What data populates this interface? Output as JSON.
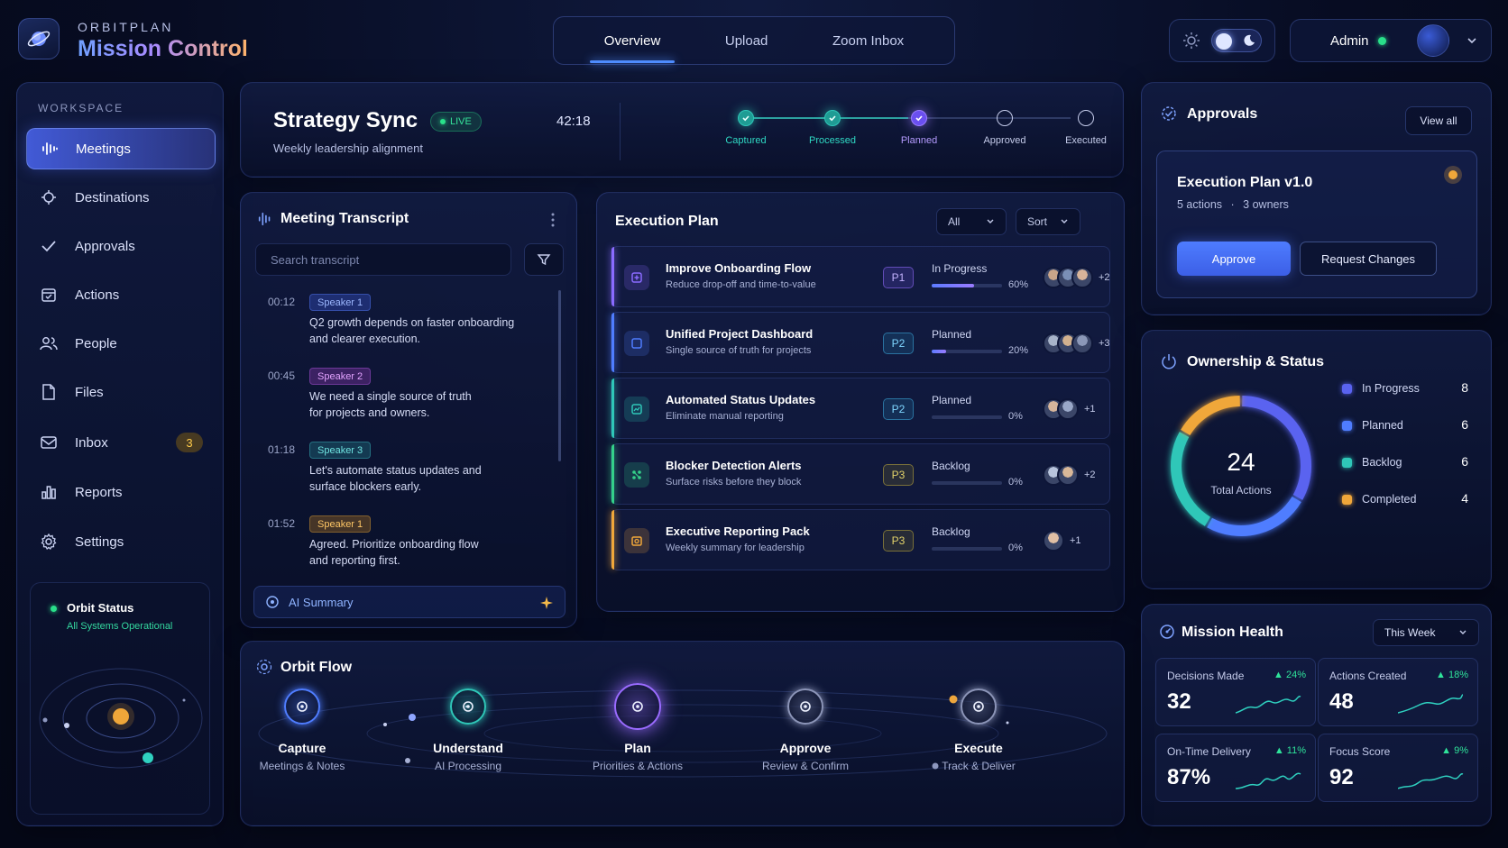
{
  "brand": {
    "top": "ORBITPLAN",
    "main": "Mission Control"
  },
  "nav_tabs": [
    "Overview",
    "Upload",
    "Zoom Inbox"
  ],
  "user": {
    "name": "Admin"
  },
  "sidebar": {
    "section": "WORKSPACE",
    "items": [
      {
        "label": "Meetings",
        "icon": "waveform-icon"
      },
      {
        "label": "Destinations",
        "icon": "target-icon"
      },
      {
        "label": "Approvals",
        "icon": "check-icon"
      },
      {
        "label": "Actions",
        "icon": "calendar-check-icon"
      },
      {
        "label": "People",
        "icon": "people-icon"
      },
      {
        "label": "Files",
        "icon": "file-icon"
      },
      {
        "label": "Inbox",
        "icon": "inbox-icon",
        "badge": "3"
      },
      {
        "label": "Reports",
        "icon": "bar-chart-icon"
      },
      {
        "label": "Settings",
        "icon": "gear-icon"
      }
    ],
    "orbit_status": {
      "title": "Orbit Status",
      "subtitle": "All Systems Operational"
    }
  },
  "meeting": {
    "title": "Strategy Sync",
    "live": "LIVE",
    "subtitle": "Weekly leadership alignment",
    "time": "42:18",
    "pipeline": [
      {
        "label": "Captured",
        "state": "done"
      },
      {
        "label": "Processed",
        "state": "done"
      },
      {
        "label": "Planned",
        "state": "current"
      },
      {
        "label": "Approved",
        "state": "todo"
      },
      {
        "label": "Executed",
        "state": "todo"
      }
    ]
  },
  "transcript": {
    "title": "Meeting Transcript",
    "search_placeholder": "Search transcript",
    "entries": [
      {
        "time": "00:12",
        "speaker": "Speaker 1",
        "line1": "Q2 growth depends on faster onboarding",
        "line2": "and clearer execution."
      },
      {
        "time": "00:45",
        "speaker": "Speaker 2",
        "line1": "We need a single source of truth",
        "line2": "for projects and owners."
      },
      {
        "time": "01:18",
        "speaker": "Speaker 3",
        "line1": "Let's automate status updates and",
        "line2": "surface blockers early."
      },
      {
        "time": "01:52",
        "speaker": "Speaker 1",
        "line1": "Agreed. Prioritize onboarding flow",
        "line2": "and reporting first."
      }
    ],
    "ai_summary": "AI Summary"
  },
  "execution_plan": {
    "title": "Execution Plan",
    "filter": "All",
    "sort": "Sort",
    "tasks": [
      {
        "title": "Improve Onboarding Flow",
        "subtitle": "Reduce drop-off and time-to-value",
        "priority": "P1",
        "status": "In Progress",
        "progress": 60,
        "progress_label": "60%",
        "more": "+2",
        "color": "#8a6bff"
      },
      {
        "title": "Unified Project Dashboard",
        "subtitle": "Single source of truth for projects",
        "priority": "P2",
        "status": "Planned",
        "progress": 20,
        "progress_label": "20%",
        "more": "+3",
        "color": "#4f7dff"
      },
      {
        "title": "Automated Status Updates",
        "subtitle": "Eliminate manual reporting",
        "priority": "P2",
        "status": "Planned",
        "progress": 0,
        "progress_label": "0%",
        "more": "+1",
        "color": "#2fc7b8"
      },
      {
        "title": "Blocker Detection Alerts",
        "subtitle": "Surface risks before they block",
        "priority": "P3",
        "status": "Backlog",
        "progress": 0,
        "progress_label": "0%",
        "more": "+2",
        "color": "#34d18a"
      },
      {
        "title": "Executive Reporting Pack",
        "subtitle": "Weekly summary for leadership",
        "priority": "P3",
        "status": "Backlog",
        "progress": 0,
        "progress_label": "0%",
        "more": "+1",
        "color": "#f0a73a"
      }
    ]
  },
  "approvals": {
    "title": "Approvals",
    "view_all": "View all",
    "plan_title": "Execution Plan v1.0",
    "plan_actions": "5 actions",
    "plan_owners": "3 owners",
    "approve": "Approve",
    "request_changes": "Request Changes"
  },
  "ownership": {
    "title": "Ownership & Status",
    "total": "24",
    "total_label": "Total Actions",
    "legend": [
      {
        "label": "In Progress",
        "value": 8,
        "color": "#5a63f0"
      },
      {
        "label": "Planned",
        "value": 6,
        "color": "#4f7dff"
      },
      {
        "label": "Backlog",
        "value": 6,
        "color": "#2fc7b8"
      },
      {
        "label": "Completed",
        "value": 4,
        "color": "#f0a73a"
      }
    ]
  },
  "health": {
    "title": "Mission Health",
    "period": "This Week",
    "metrics": [
      {
        "label": "Decisions Made",
        "value": "32",
        "delta": "24%"
      },
      {
        "label": "Actions Created",
        "value": "48",
        "delta": "18%"
      },
      {
        "label": "On-Time Delivery",
        "value": "87%",
        "delta": "11%"
      },
      {
        "label": "Focus Score",
        "value": "92",
        "delta": "9%"
      }
    ]
  },
  "orbit_flow": {
    "title": "Orbit Flow",
    "stages": [
      {
        "title": "Capture",
        "subtitle": "Meetings & Notes",
        "color": "#4f7dff"
      },
      {
        "title": "Understand",
        "subtitle": "AI Processing",
        "color": "#2fc7b8"
      },
      {
        "title": "Plan",
        "subtitle": "Priorities & Actions",
        "color": "#9a6bff"
      },
      {
        "title": "Approve",
        "subtitle": "Review & Confirm",
        "color": "#8c95b8"
      },
      {
        "title": "Execute",
        "subtitle": "Track & Deliver",
        "color": "#8c95b8"
      }
    ]
  }
}
